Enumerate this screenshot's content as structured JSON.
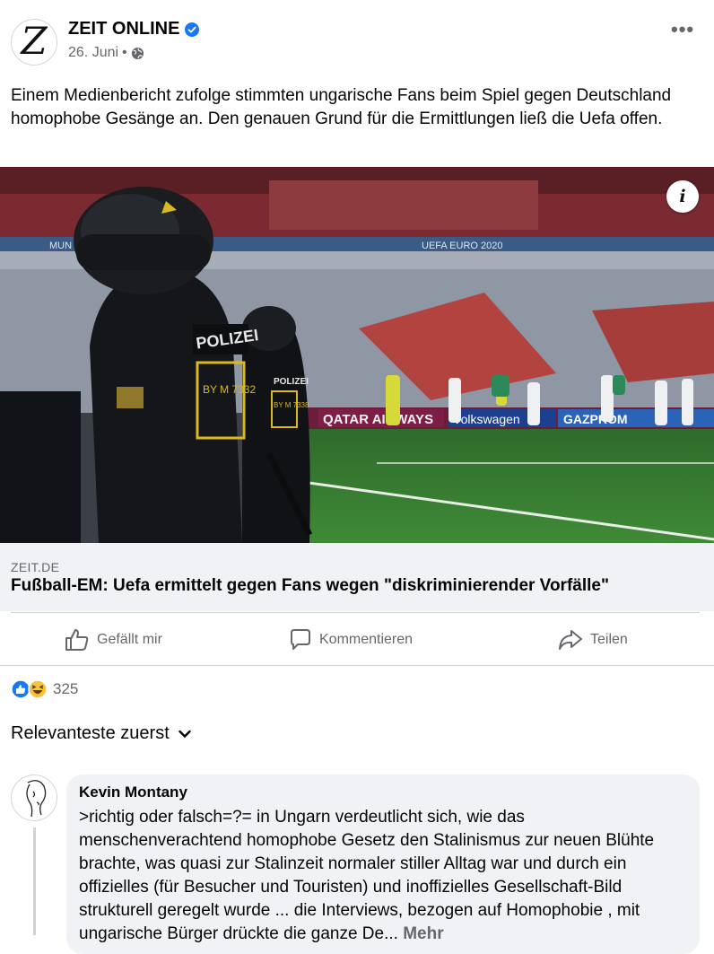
{
  "post": {
    "page_name": "ZEIT ONLINE",
    "avatar_letter": "Z",
    "date": "26. Juni",
    "separator": "•",
    "text": "Einem Medienbericht zufolge stimmten ungarische Fans beim Spiel gegen Deutschland homophobe Gesänge an. Den genauen Grund für die Ermittlungen ließ die Uefa offen.",
    "more_menu": "•••",
    "icons": {
      "verified": "verified-badge-icon",
      "privacy": "globe-icon",
      "menu": "more-options-icon"
    }
  },
  "image": {
    "info_label": "i",
    "police_labels": [
      "POLIZEI",
      "BY M 7332",
      "POLIZEI",
      "BY M 7338"
    ],
    "stadium_text": [
      "MUN",
      "UEFA EURO 2020"
    ],
    "ads": [
      "QATAR AIRWAYS",
      "Volkswagen",
      "GAZPROM"
    ]
  },
  "link_preview": {
    "domain": "ZEIT.DE",
    "title": "Fußball-EM: Uefa ermittelt gegen Fans wegen \"diskriminierender Vorfälle\""
  },
  "actions": {
    "like": "Gefällt mir",
    "comment": "Kommentieren",
    "share": "Teilen"
  },
  "reactions": {
    "count": "325",
    "types": [
      "like",
      "haha"
    ]
  },
  "comments_sort": {
    "label": "Relevanteste zuerst"
  },
  "comment": {
    "author": "Kevin Montany",
    "text": ">richtig oder falsch=?= in Ungarn  verdeutlicht sich, wie das menschenverachtend  homophobe Gesetz den Stalinismus zur neuen Blühte brachte, was quasi zur Stalinzeit normaler stiller Alltag war und durch ein offizielles (für Besucher und Touristen) und inoffizielles Gesellschaft-Bild strukturell geregelt wurde ... die Interviews, bezogen auf Homophobie , mit ungarische Bürger drückte die ganze De...",
    "more": "Mehr"
  },
  "colors": {
    "accent": "#1877f2",
    "secondary_text": "#65676b",
    "divider": "#ced0d4",
    "bubble": "#f0f2f5"
  }
}
